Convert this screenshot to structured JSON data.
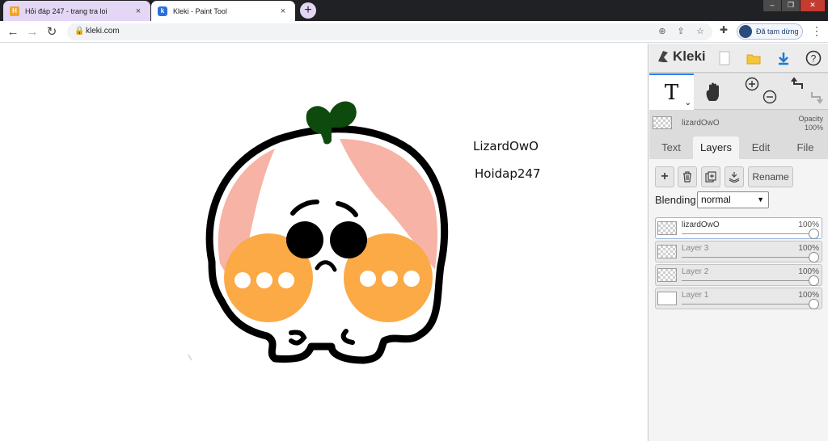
{
  "browser": {
    "tabs": [
      {
        "title": "Hỏi đáp 247 - trang tra loi",
        "favicon": "hoidap-favicon",
        "active": false
      },
      {
        "title": "Kleki - Paint Tool",
        "favicon": "kleki-favicon",
        "active": true
      }
    ],
    "new_tab_label": "+",
    "close_label": "×",
    "url": "kleki.com",
    "profile_label": "Đã tạm dừng",
    "colors": {
      "active_tab": "#ffffff",
      "inactive_tab": "#e4d7f5",
      "frame": "#202124"
    }
  },
  "canvas": {
    "texts": [
      "LizardOwO",
      "Hoidap247"
    ],
    "colors": {
      "outline": "#000000",
      "blush": "#f7b3a6",
      "cheek": "#fbaa46",
      "sprout": "#0e4a0e"
    }
  },
  "kleki": {
    "logo": "Kleki",
    "tool_text": "T",
    "tool_caret": "⌄",
    "current_layer": {
      "name": "lizardOwO",
      "opacity_label": "Opacity",
      "opacity_value": "100%"
    },
    "tabs": [
      "Text",
      "Layers",
      "Edit",
      "File"
    ],
    "active_tab": "Layers",
    "layer_buttons": {
      "add": "+",
      "delete": "delete-icon",
      "duplicate": "duplicate-icon",
      "merge": "merge-down-icon",
      "rename": "Rename"
    },
    "blending_label": "Blending",
    "blending_value": "normal",
    "layers": [
      {
        "name": "lizardOwO",
        "opacity": "100%",
        "selected": true
      },
      {
        "name": "Layer 3",
        "opacity": "100%",
        "selected": false
      },
      {
        "name": "Layer 2",
        "opacity": "100%",
        "selected": false
      },
      {
        "name": "Layer 1",
        "opacity": "100%",
        "selected": false
      }
    ],
    "colors": {
      "accent": "#2d7ff9",
      "panel": "#dcdcdc",
      "tab_body": "#f4f4f4"
    }
  }
}
